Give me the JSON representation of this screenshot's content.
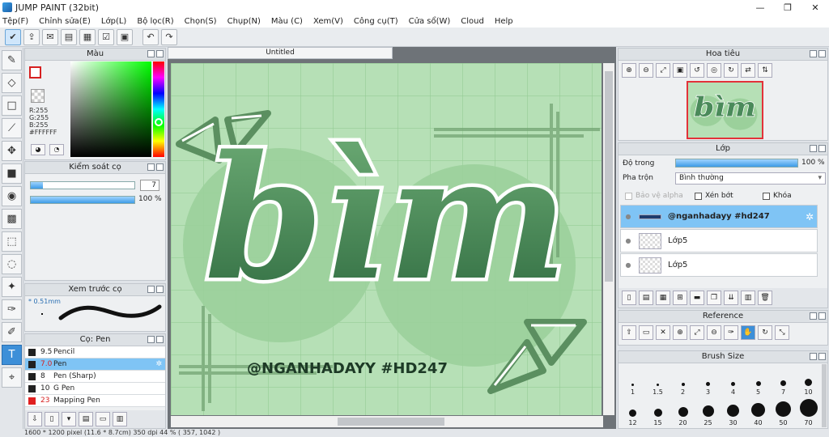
{
  "window": {
    "title": "JUMP PAINT (32bit)",
    "controls": [
      "—",
      "❐",
      "✕"
    ]
  },
  "menu": [
    "Tệp(F)",
    "Chỉnh sửa(E)",
    "Lớp(L)",
    "Bộ lọc(R)",
    "Chọn(S)",
    "Chụp(N)",
    "Màu (C)",
    "Xem(V)",
    "Công cụ(T)",
    "Cửa sổ(W)",
    "Cloud",
    "Help"
  ],
  "color_panel": {
    "title": "Màu",
    "r": "R:255",
    "g": "G:255",
    "b": "B:255",
    "hex": "#FFFFFF",
    "accent": "#d62020"
  },
  "brush_control": {
    "title": "Kiểm soát cọ",
    "size_value": "7",
    "size_fraction": 0.12,
    "opacity_value": "100 %",
    "opacity_fraction": 1.0
  },
  "brush_preview": {
    "title": "Xem trước cọ",
    "size": "0.51mm"
  },
  "brush_list": {
    "title": "Cọ: Pen",
    "items": [
      {
        "size": "9.5",
        "name": "Pencil",
        "color": "#222222",
        "selected": false
      },
      {
        "size": "7.0",
        "name": "Pen",
        "color": "#222222",
        "selected": true
      },
      {
        "size": "8",
        "name": "Pen (Sharp)",
        "color": "#222222",
        "selected": false
      },
      {
        "size": "10",
        "name": "G Pen",
        "color": "#222222",
        "selected": false
      },
      {
        "size": "23",
        "name": "Mapping Pen",
        "color": "#e02020",
        "selected": false
      }
    ]
  },
  "document": {
    "tab": "Untitled",
    "artwork_text": "bìm",
    "artwork_caption": "@NGANHADAYY #HD247",
    "bg_color": "#b6e0b6",
    "ink_color": "#4a8a5a"
  },
  "status": {
    "text": "1600 * 1200 pixel  (11.6 * 8.7cm)  350 dpi  44 %  ( 357, 1042 )"
  },
  "navigator": {
    "title": "Hoa tiêu"
  },
  "layers": {
    "title": "Lớp",
    "opacity_label": "Độ trong",
    "opacity_value": "100 %",
    "blend_label": "Pha trộn",
    "blend_value": "Bình thường",
    "protect_alpha": "Bảo vệ alpha",
    "clipping": "Xén bớt",
    "lock": "Khóa",
    "items": [
      {
        "name": "@nganhadayy #hd247",
        "selected": true
      },
      {
        "name": "Lớp5",
        "selected": false
      },
      {
        "name": "Lớp5",
        "selected": false
      }
    ]
  },
  "reference": {
    "title": "Reference"
  },
  "brush_size": {
    "title": "Brush Size",
    "sizes": [
      "1",
      "1.5",
      "2",
      "3",
      "4",
      "5",
      "7",
      "10",
      "12",
      "15",
      "20",
      "25",
      "30",
      "40",
      "50",
      "70"
    ]
  }
}
